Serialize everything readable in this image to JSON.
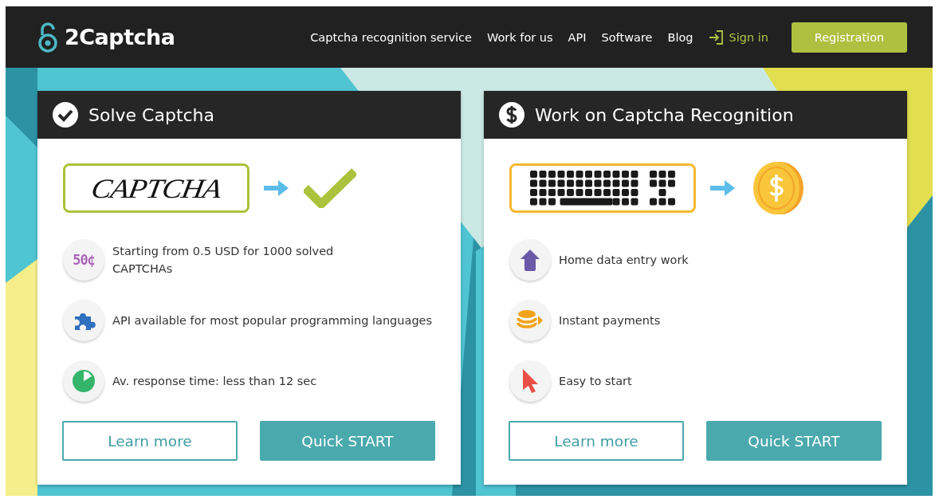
{
  "header": {
    "logo": "2Captcha",
    "nav": [
      "Captcha recognition service",
      "Work for us",
      "API",
      "Software",
      "Blog"
    ],
    "sign_in": "Sign in",
    "register": "Registration"
  },
  "cards": [
    {
      "title": "Solve Captcha",
      "captcha_text": "CAPTCHA",
      "features": [
        {
          "badge": "50¢",
          "text": "Starting from 0.5 USD for 1000 solved CAPTCHAs"
        },
        {
          "text": "API available for most popular programming languages"
        },
        {
          "text": "Av. response time: less than 12 sec"
        }
      ],
      "buttons": [
        "Learn more",
        "Quick START"
      ]
    },
    {
      "title": "Work on Captcha Recognition",
      "features": [
        {
          "text": "Home data entry work"
        },
        {
          "text": "Instant payments"
        },
        {
          "text": "Easy to start"
        }
      ],
      "buttons": [
        "Learn more",
        "Quick START"
      ]
    }
  ]
}
